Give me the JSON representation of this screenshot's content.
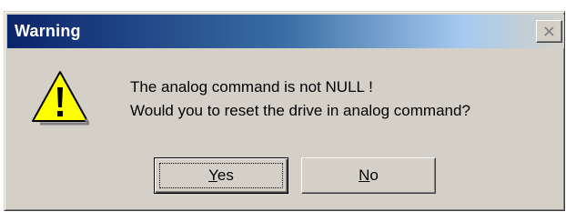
{
  "window": {
    "title": "Warning",
    "close_icon": "close-x-icon"
  },
  "message": {
    "icon": "warning-exclamation-icon",
    "line1": "The analog command is not NULL !",
    "line2": "Would you to reset the drive in analog command?"
  },
  "buttons": {
    "yes": {
      "mnemonic": "Y",
      "rest": "es"
    },
    "no": {
      "mnemonic": "N",
      "rest": "o"
    }
  },
  "colors": {
    "dialog_bg": "#d4d0c8",
    "titlebar_start": "#0a246a",
    "titlebar_end": "#a6caf0",
    "warning_yellow": "#ffff00"
  }
}
